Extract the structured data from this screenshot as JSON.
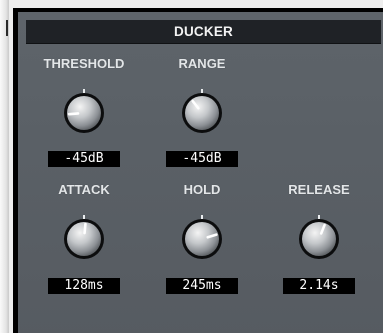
{
  "module": {
    "title": "DUCKER"
  },
  "controls": [
    {
      "id": "threshold",
      "label": "THRESHOLD",
      "value": "-45dB",
      "position": 0.15
    },
    {
      "id": "range",
      "label": "RANGE",
      "value": "-45dB",
      "position": 0.36
    },
    {
      "id": "attack",
      "label": "ATTACK",
      "value": "128ms",
      "position": 0.52
    },
    {
      "id": "hold",
      "label": "HOLD",
      "value": "245ms",
      "position": 0.77
    },
    {
      "id": "release",
      "label": "RELEASE",
      "value": "2.14s",
      "position": 0.58
    }
  ],
  "colors": {
    "panel": "#5a6066",
    "title_bar": "#1f2226",
    "label_text": "#e3e6e8",
    "value_box": "#000000",
    "value_text": "#ffffff",
    "knob_indicator": "#ffffff"
  }
}
